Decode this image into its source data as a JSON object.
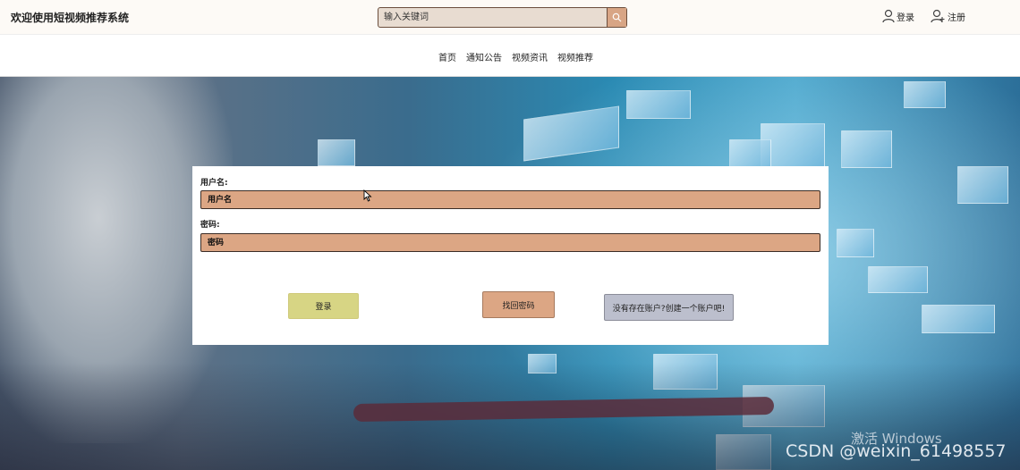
{
  "header": {
    "site_title": "欢迎使用短视频推荐系统",
    "search": {
      "placeholder": "输入关键词",
      "icon": "search-icon"
    },
    "login_link": "登录",
    "register_link": "注册"
  },
  "nav": {
    "items": [
      "首页",
      "通知公告",
      "视频资讯",
      "视频推荐"
    ]
  },
  "login_form": {
    "username_label": "用户名:",
    "username_placeholder": "用户名",
    "password_label": "密码:",
    "password_placeholder": "密码",
    "login_button": "登录",
    "forgot_button": "找回密码",
    "register_button": "没有存在账户?创建一个账户吧!"
  },
  "overlays": {
    "os_watermark": "激活 Windows",
    "site_watermark": "CSDN @weixin_61498557"
  },
  "colors": {
    "input_fill": "#dca684",
    "login_button": "#d7d584",
    "forgot_button": "#dca684",
    "register_button": "#bcbfcd",
    "search_button": "#d8a585"
  }
}
